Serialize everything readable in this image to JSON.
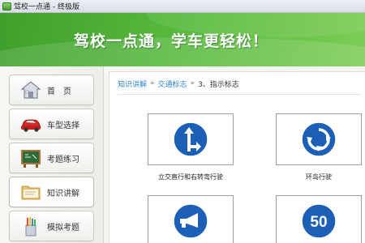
{
  "window": {
    "title": "驾校一点通 - 终极版"
  },
  "banner": {
    "slogan": "驾校一点通，学车更轻松！"
  },
  "sidebar": {
    "items": [
      {
        "label": "首　页",
        "icon": "house-icon"
      },
      {
        "label": "车型选择",
        "icon": "red-car-icon"
      },
      {
        "label": "考题练习",
        "icon": "chalkboard-icon"
      },
      {
        "label": "知识讲解",
        "icon": "folder-icon"
      },
      {
        "label": "模拟考题",
        "icon": "pencil-cup-icon"
      }
    ]
  },
  "breadcrumb": {
    "items": [
      "知识讲解",
      "交通标志"
    ],
    "separator": "»",
    "current": "3、指示标志"
  },
  "signs": [
    {
      "caption": "立交直行和右转弯行驶",
      "icon": "straight-and-right-turn-sign"
    },
    {
      "caption": "环岛行驶",
      "icon": "roundabout-sign"
    },
    {
      "caption": "",
      "icon": "horn-sign"
    },
    {
      "caption": "",
      "icon": "minimum-speed-sign",
      "value": "50"
    }
  ],
  "colors": {
    "banner_green": "#4fb238",
    "link_blue": "#2f86c9",
    "sign_blue": "#1c5fb6"
  }
}
